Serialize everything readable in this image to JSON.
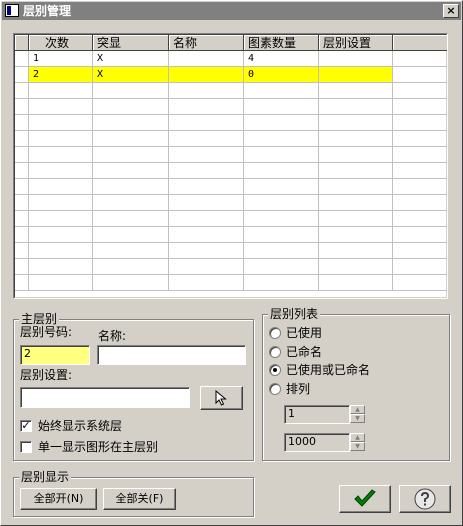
{
  "window": {
    "title": "层别管理",
    "close_glyph": "×"
  },
  "grid": {
    "columns": [
      "次数",
      "突显",
      "名称",
      "图素数量",
      "层别设置"
    ],
    "rows": [
      {
        "n": "1",
        "show": "X",
        "name": "",
        "count": "4",
        "setting": ""
      },
      {
        "n": "2",
        "show": "X",
        "name": "",
        "count": "0",
        "setting": ""
      }
    ],
    "selected_row": 1,
    "highlight_color": "#ffff00"
  },
  "main_layer": {
    "legend": "主层别",
    "number_label": "层别号码:",
    "number_value": "2",
    "name_label": "名称:",
    "name_value": "",
    "setting_label": "层别设置:",
    "setting_value": "",
    "always_show_label": "始终显示系统层",
    "always_show_checked": true,
    "single_show_label": "单一显示图形在主层别",
    "single_show_checked": false
  },
  "layer_list": {
    "legend": "层别列表",
    "options": [
      "已使用",
      "已命名",
      "已使用或已命名",
      "排列"
    ],
    "selected": 2,
    "range_from": "1",
    "range_to": "1000"
  },
  "layer_display": {
    "legend": "层别显示",
    "all_on": "全部开(N)",
    "all_off": "全部关(F)"
  },
  "footer": {
    "ok_color": "#008000"
  }
}
